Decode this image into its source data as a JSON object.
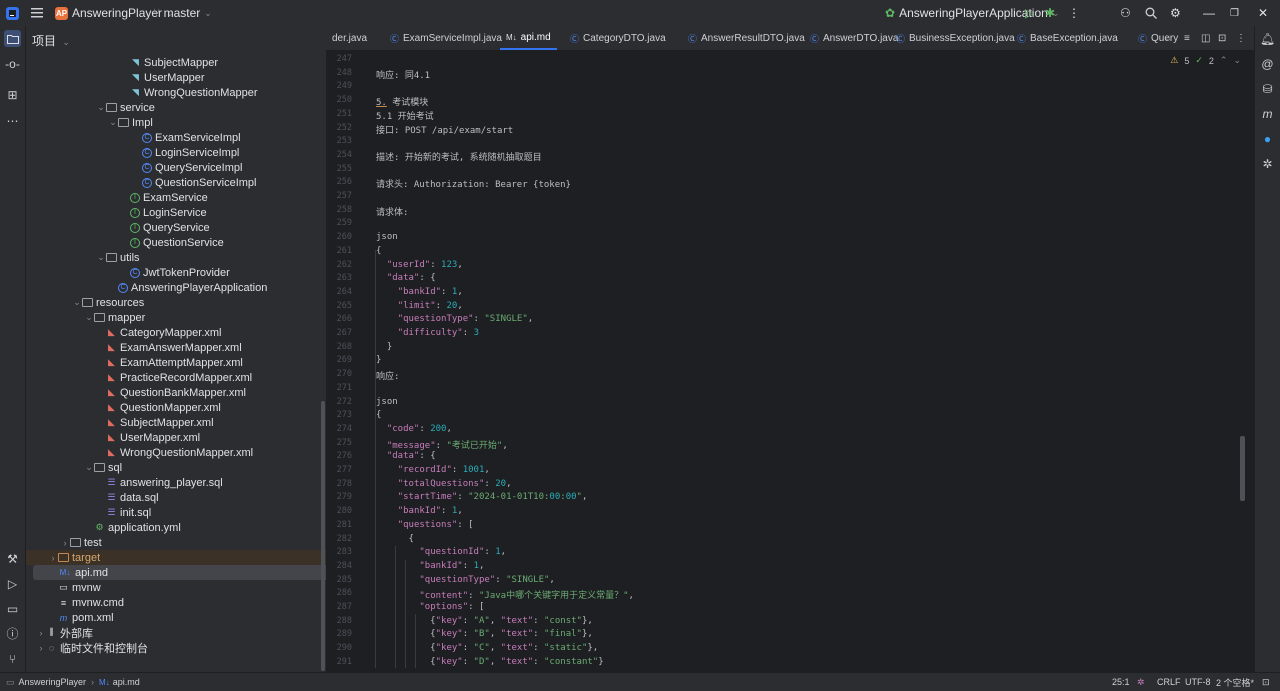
{
  "titlebar": {
    "project_badge": "AP",
    "project_name": "AnsweringPlayer",
    "branch": "master",
    "run_config": "AnsweringPlayerApplication"
  },
  "project_panel": {
    "title": "项目",
    "tree": [
      {
        "label": "SubjectMapper",
        "icon": "mapper",
        "indent": 7
      },
      {
        "label": "UserMapper",
        "icon": "mapper",
        "indent": 7
      },
      {
        "label": "WrongQuestionMapper",
        "icon": "mapper",
        "indent": 7
      },
      {
        "label": "service",
        "icon": "folder",
        "indent": 5,
        "chev": "v"
      },
      {
        "label": "Impl",
        "icon": "folder",
        "indent": 6,
        "chev": "v"
      },
      {
        "label": "ExamServiceImpl",
        "icon": "class",
        "indent": 8
      },
      {
        "label": "LoginServiceImpl",
        "icon": "class",
        "indent": 8
      },
      {
        "label": "QueryServiceImpl",
        "icon": "class",
        "indent": 8
      },
      {
        "label": "QuestionServiceImpl",
        "icon": "class",
        "indent": 8
      },
      {
        "label": "ExamService",
        "icon": "iface",
        "indent": 7
      },
      {
        "label": "LoginService",
        "icon": "iface",
        "indent": 7
      },
      {
        "label": "QueryService",
        "icon": "iface",
        "indent": 7
      },
      {
        "label": "QuestionService",
        "icon": "iface",
        "indent": 7
      },
      {
        "label": "utils",
        "icon": "folder",
        "indent": 5,
        "chev": "v"
      },
      {
        "label": "JwtTokenProvider",
        "icon": "class",
        "indent": 7
      },
      {
        "label": "AnsweringPlayerApplication",
        "icon": "class",
        "indent": 6
      },
      {
        "label": "resources",
        "icon": "folder",
        "indent": 3,
        "chev": "v"
      },
      {
        "label": "mapper",
        "icon": "folder",
        "indent": 4,
        "chev": "v"
      },
      {
        "label": "CategoryMapper.xml",
        "icon": "xml",
        "indent": 5
      },
      {
        "label": "ExamAnswerMapper.xml",
        "icon": "xml",
        "indent": 5
      },
      {
        "label": "ExamAttemptMapper.xml",
        "icon": "xml",
        "indent": 5
      },
      {
        "label": "PracticeRecordMapper.xml",
        "icon": "xml",
        "indent": 5
      },
      {
        "label": "QuestionBankMapper.xml",
        "icon": "xml",
        "indent": 5
      },
      {
        "label": "QuestionMapper.xml",
        "icon": "xml",
        "indent": 5
      },
      {
        "label": "SubjectMapper.xml",
        "icon": "xml",
        "indent": 5
      },
      {
        "label": "UserMapper.xml",
        "icon": "xml",
        "indent": 5
      },
      {
        "label": "WrongQuestionMapper.xml",
        "icon": "xml",
        "indent": 5
      },
      {
        "label": "sql",
        "icon": "folder",
        "indent": 4,
        "chev": "v"
      },
      {
        "label": "answering_player.sql",
        "icon": "sql",
        "indent": 5
      },
      {
        "label": "data.sql",
        "icon": "sql",
        "indent": 5
      },
      {
        "label": "init.sql",
        "icon": "sql",
        "indent": 5
      },
      {
        "label": "application.yml",
        "icon": "yml",
        "indent": 4
      },
      {
        "label": "test",
        "icon": "folder",
        "indent": 2,
        "chev": ">"
      },
      {
        "label": "target",
        "icon": "folder-orange",
        "indent": 1,
        "chev": ">",
        "hl": "orange"
      },
      {
        "label": "api.md",
        "icon": "md",
        "indent": 1,
        "hl": "selected"
      },
      {
        "label": "mvnw",
        "icon": "file",
        "indent": 1
      },
      {
        "label": "mvnw.cmd",
        "icon": "lines",
        "indent": 1
      },
      {
        "label": "pom.xml",
        "icon": "maven",
        "indent": 1
      },
      {
        "label": "外部库",
        "icon": "lib",
        "indent": 0,
        "chev": ">"
      },
      {
        "label": "临时文件和控制台",
        "icon": "scratch",
        "indent": 0,
        "chev": ">"
      }
    ]
  },
  "tabs": [
    {
      "label": "der.java",
      "icon": ""
    },
    {
      "label": "ExamServiceImpl.java",
      "icon": "C"
    },
    {
      "label": "api.md",
      "icon": "M↓",
      "active": true
    },
    {
      "label": "CategoryDTO.java",
      "icon": "C"
    },
    {
      "label": "AnswerResultDTO.java",
      "icon": "C"
    },
    {
      "label": "AnswerDTO.java",
      "icon": "C"
    },
    {
      "label": "BusinessException.java",
      "icon": "C"
    },
    {
      "label": "BaseException.java",
      "icon": "C"
    },
    {
      "label": "Query",
      "icon": "C"
    }
  ],
  "inspections": {
    "warnings": "5",
    "weak": "2"
  },
  "code_lines": [
    {
      "n": "247",
      "t": ""
    },
    {
      "n": "248",
      "t": "响应: 同4.1"
    },
    {
      "n": "249",
      "t": ""
    },
    {
      "n": "250",
      "t": "5. 考试模块"
    },
    {
      "n": "251",
      "t": "5.1 开始考试"
    },
    {
      "n": "252",
      "t": "接口: POST /api/exam/start"
    },
    {
      "n": "253",
      "t": ""
    },
    {
      "n": "254",
      "t": "描述: 开始新的考试, 系统随机抽取题目"
    },
    {
      "n": "255",
      "t": ""
    },
    {
      "n": "256",
      "t": "请求头: Authorization: Bearer {token}"
    },
    {
      "n": "257",
      "t": ""
    },
    {
      "n": "258",
      "t": "请求体:"
    },
    {
      "n": "259",
      "t": ""
    },
    {
      "n": "260",
      "t": "json"
    },
    {
      "n": "261",
      "t": "{"
    },
    {
      "n": "262",
      "t": "  \"userId\": 123,"
    },
    {
      "n": "263",
      "t": "  \"data\": {"
    },
    {
      "n": "264",
      "t": "    \"bankId\": 1,"
    },
    {
      "n": "265",
      "t": "    \"limit\": 20,"
    },
    {
      "n": "266",
      "t": "    \"questionType\": \"SINGLE\","
    },
    {
      "n": "267",
      "t": "    \"difficulty\": 3"
    },
    {
      "n": "268",
      "t": "  }"
    },
    {
      "n": "269",
      "t": "}"
    },
    {
      "n": "270",
      "t": "响应:"
    },
    {
      "n": "271",
      "t": ""
    },
    {
      "n": "272",
      "t": "json"
    },
    {
      "n": "273",
      "t": "{"
    },
    {
      "n": "274",
      "t": "  \"code\": 200,"
    },
    {
      "n": "275",
      "t": "  \"message\": \"考试已开始\","
    },
    {
      "n": "276",
      "t": "  \"data\": {"
    },
    {
      "n": "277",
      "t": "    \"recordId\": 1001,"
    },
    {
      "n": "278",
      "t": "    \"totalQuestions\": 20,"
    },
    {
      "n": "279",
      "t": "    \"startTime\": \"2024-01-01T10:00:00\","
    },
    {
      "n": "280",
      "t": "    \"bankId\": 1,"
    },
    {
      "n": "281",
      "t": "    \"questions\": ["
    },
    {
      "n": "282",
      "t": "      {"
    },
    {
      "n": "283",
      "t": "        \"questionId\": 1,"
    },
    {
      "n": "284",
      "t": "        \"bankId\": 1,"
    },
    {
      "n": "285",
      "t": "        \"questionType\": \"SINGLE\","
    },
    {
      "n": "286",
      "t": "        \"content\": \"Java中哪个关键字用于定义常量？\","
    },
    {
      "n": "287",
      "t": "        \"options\": ["
    },
    {
      "n": "288",
      "t": "          {\"key\": \"A\", \"text\": \"const\"},"
    },
    {
      "n": "289",
      "t": "          {\"key\": \"B\", \"text\": \"final\"},"
    },
    {
      "n": "290",
      "t": "          {\"key\": \"C\", \"text\": \"static\"},"
    },
    {
      "n": "291",
      "t": "          {\"key\": \"D\", \"text\": \"constant\"}"
    }
  ],
  "statusbar": {
    "crumb_project": "AnsweringPlayer",
    "crumb_file": "api.md",
    "crumb_file_icon": "M↓",
    "position": "25:1",
    "line_sep": "CRLF",
    "encoding": "UTF-8",
    "indent": "2 个空格*"
  },
  "colors": {
    "accent": "#3574f0",
    "background": "#1e1f22",
    "panel": "#2b2d30"
  }
}
